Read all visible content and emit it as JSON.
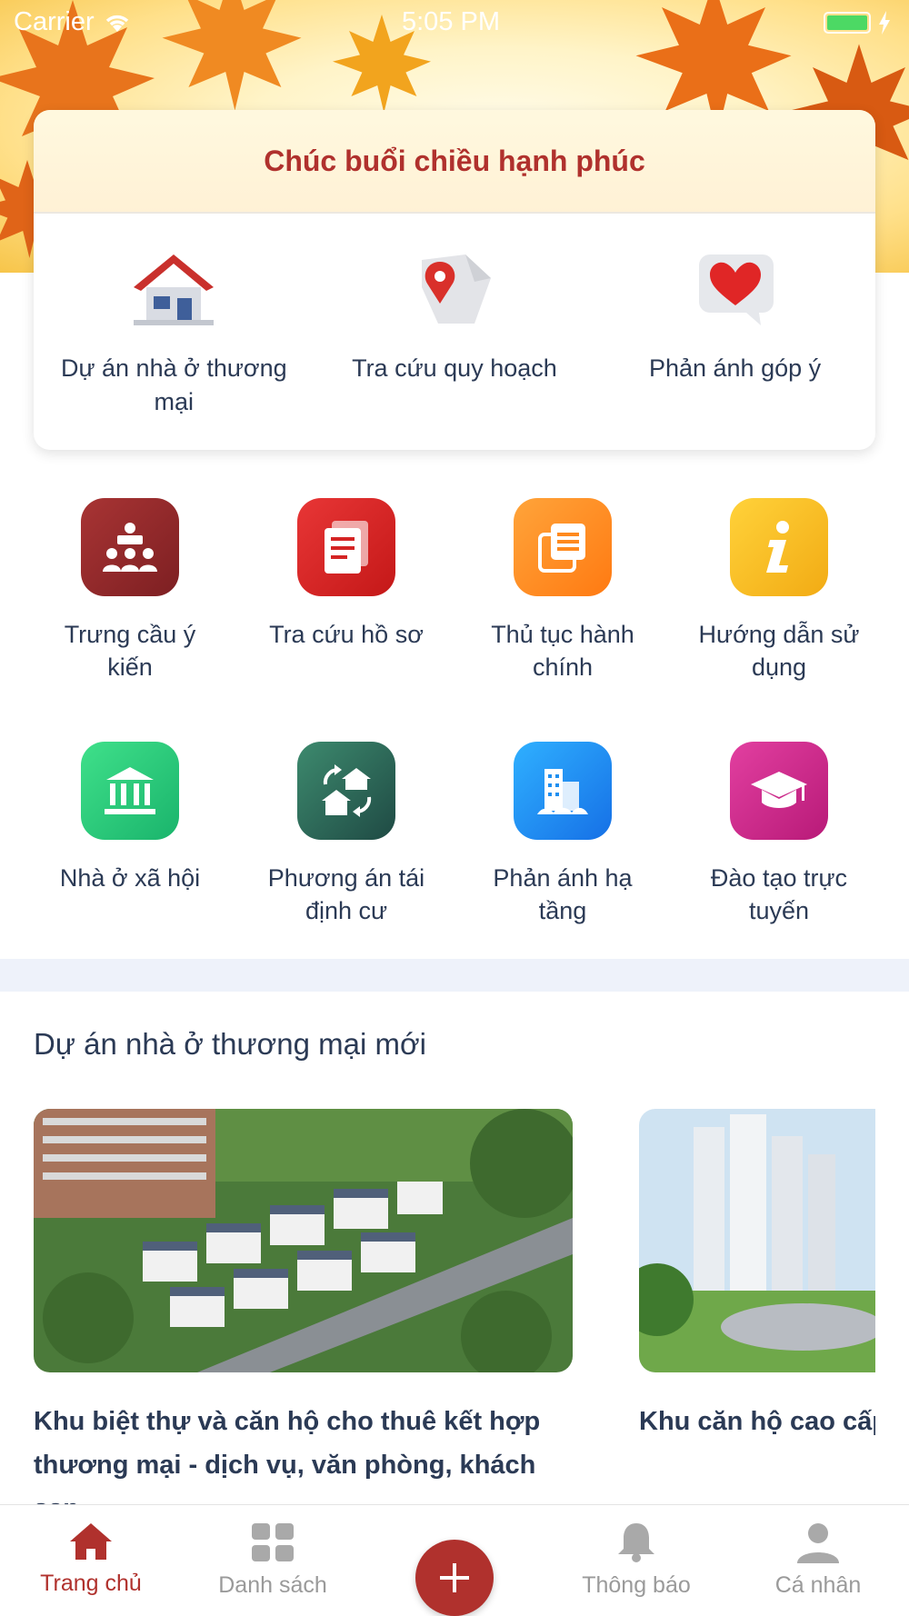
{
  "status_bar": {
    "carrier": "Carrier",
    "time": "5:05 PM",
    "icons": [
      "wifi-icon",
      "battery-icon",
      "charging-icon"
    ],
    "battery_color": "#4cd964"
  },
  "greeting": {
    "title": "Chúc buổi chiều hạnh phúc",
    "title_color": "#b0312d"
  },
  "quick_actions": [
    {
      "label": "Dự án nhà ở thương mại",
      "icon": "house-icon"
    },
    {
      "label": "Tra cứu quy hoạch",
      "icon": "map-pin-icon"
    },
    {
      "label": "Phản ánh góp ý",
      "icon": "heart-chat-icon"
    }
  ],
  "services": [
    {
      "label": "Trưng cầu ý kiến",
      "icon": "audience-icon",
      "color": "#9a2a2a"
    },
    {
      "label": "Tra cứu hồ sơ",
      "icon": "document-icon",
      "color": "#d42424"
    },
    {
      "label": "Thủ tục hành chính",
      "icon": "papers-icon",
      "color": "#ff8a1e"
    },
    {
      "label": "Hướng dẫn sử dụng",
      "icon": "info-icon",
      "color": "#f5b81f"
    },
    {
      "label": "Nhà ở xã hội",
      "icon": "building-columns-icon",
      "color": "#27c97c"
    },
    {
      "label": "Phương án tái định cư",
      "icon": "relocation-icon",
      "color": "#2f6b58"
    },
    {
      "label": "Phản ánh hạ tầng",
      "icon": "city-icon",
      "color": "#1f8ff0"
    },
    {
      "label": "Đào tạo trực tuyến",
      "icon": "graduation-cap-icon",
      "color": "#cf2a8c"
    }
  ],
  "projects": {
    "title": "Dự án nhà ở thương mại mới",
    "items": [
      {
        "name": "Khu biệt thự và căn hộ cho thuê kết hợp thương mại - dịch vụ, văn phòng, khách sạn"
      },
      {
        "name": "Khu căn hộ cao cấp"
      }
    ]
  },
  "tab_bar": {
    "tabs": [
      {
        "label": "Trang chủ",
        "icon": "home-icon",
        "active": true
      },
      {
        "label": "Danh sách",
        "icon": "grid-icon",
        "active": false
      },
      {
        "label": "",
        "icon": "plus-icon",
        "active": false
      },
      {
        "label": "Thông báo",
        "icon": "bell-icon",
        "active": false
      },
      {
        "label": "Cá nhân",
        "icon": "person-icon",
        "active": false
      }
    ],
    "active_color": "#b0312d",
    "inactive_color": "#9a9a9a"
  }
}
